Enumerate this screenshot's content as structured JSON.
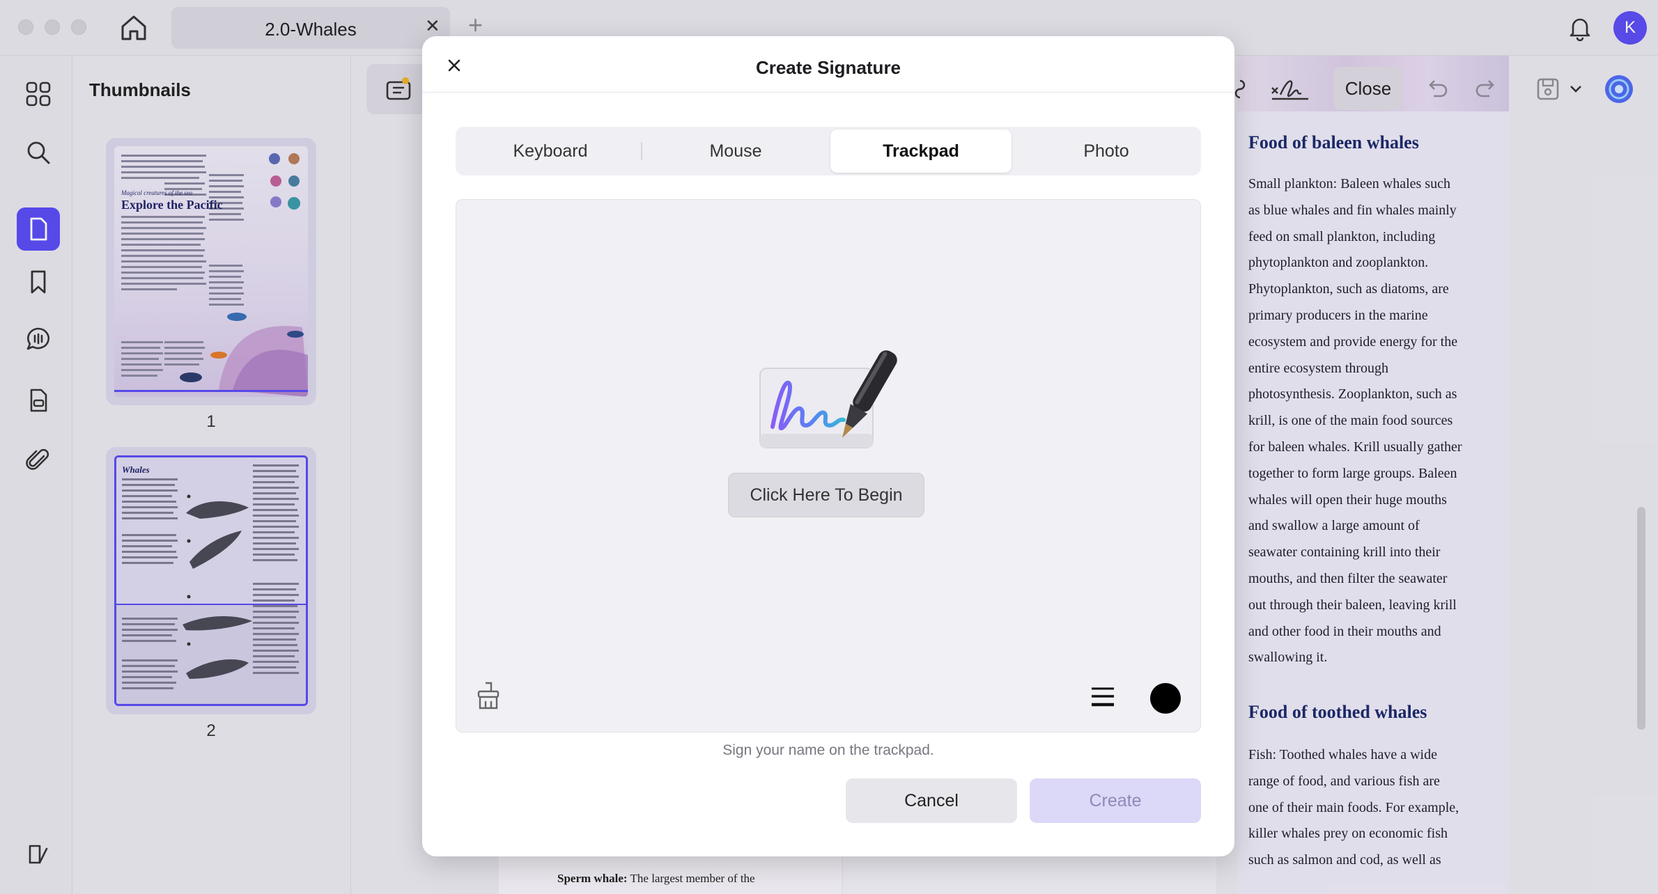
{
  "tab": {
    "title": "2.0-Whales",
    "close": "✕",
    "add": "+"
  },
  "user": {
    "initial": "K"
  },
  "thumbnails": {
    "title": "Thumbnails",
    "pages": [
      {
        "number": "1",
        "kicker": "Magical creatures of the sea",
        "heading": "Explore the Pacific"
      },
      {
        "number": "2",
        "heading": "Whales"
      }
    ]
  },
  "toolbar": {
    "close_label": "Close"
  },
  "document": {
    "heading1": "Food of baleen whales",
    "para1": "Small plankton: Baleen whales such\nas blue whales and fin whales mainly\nfeed on small plankton, including\nphytoplankton and zooplankton.\nPhytoplankton, such as diatoms, are\nprimary producers in the marine\necosystem and provide energy for the\nentire ecosystem through\nphotosynthesis. Zooplankton, such as\nkrill, is one of the main food sources\nfor baleen whales. Krill usually gather\ntogether to form large groups. Baleen\nwhales will open their huge mouths\nand swallow a large amount of\nseawater containing krill into their\nmouths, and then filter the seawater\nout through their baleen, leaving krill\nand other food in their mouths and\nswallowing it.",
    "heading2": "Food of toothed whales",
    "para2": "Fish: Toothed whales have a wide\nrange of food, and various fish are\none of their main foods. For example,\nkiller whales prey on economic fish\nsuch as salmon and cod, as well as",
    "bottom_left_bold": "Sperm whale:",
    "bottom_left_text": " The largest member of the"
  },
  "modal": {
    "title": "Create Signature",
    "close": "✕",
    "tabs": [
      "Keyboard",
      "Mouse",
      "Trackpad",
      "Photo"
    ],
    "active_tab": "Trackpad",
    "begin_label": "Click Here To Begin",
    "hint": "Sign your name on the trackpad.",
    "cancel_label": "Cancel",
    "create_label": "Create",
    "pen_color": "#000000"
  },
  "colors": {
    "accent": "#5a4cf2",
    "create_disabled_bg": "#dcd8f7"
  }
}
